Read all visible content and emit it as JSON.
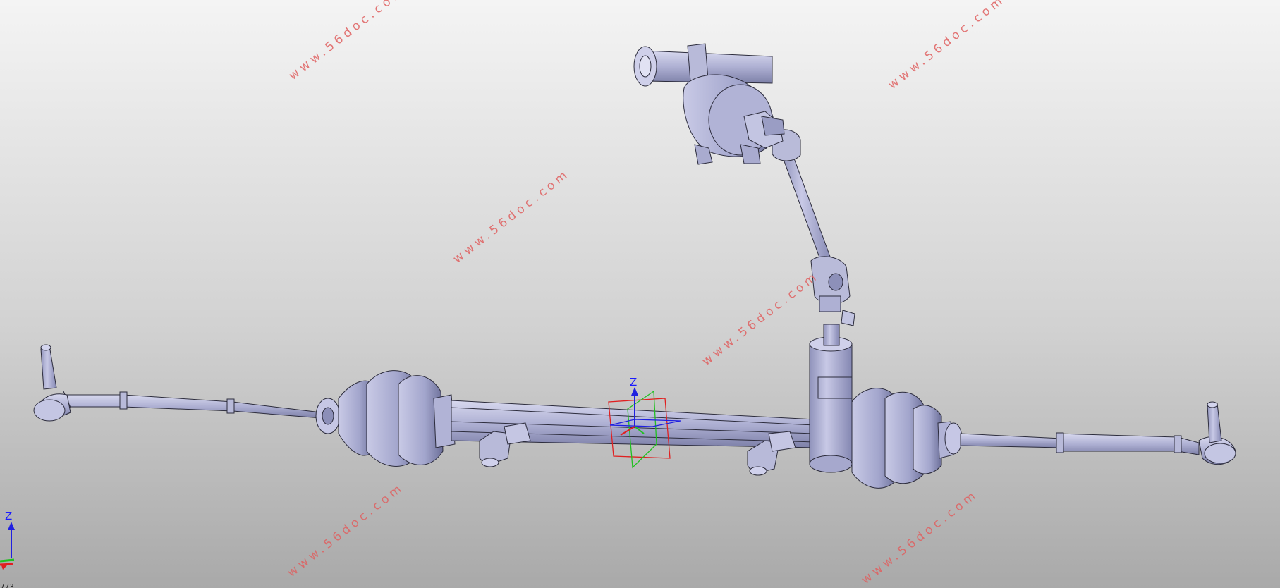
{
  "viewport": {
    "background_top": "#f4f4f4",
    "background_bottom": "#a9a9a9",
    "part_color": "#b4b6d8",
    "part_edge": "#2c2c3c"
  },
  "watermark": {
    "text": "www.56doc.com",
    "color": "#e06060"
  },
  "compass": {
    "z_label": "Z",
    "colors": {
      "x": "#e02020",
      "y": "#20c020",
      "z": "#2020e0"
    }
  },
  "axis_triad": {
    "z_label": "Z"
  },
  "corner_label": "773"
}
